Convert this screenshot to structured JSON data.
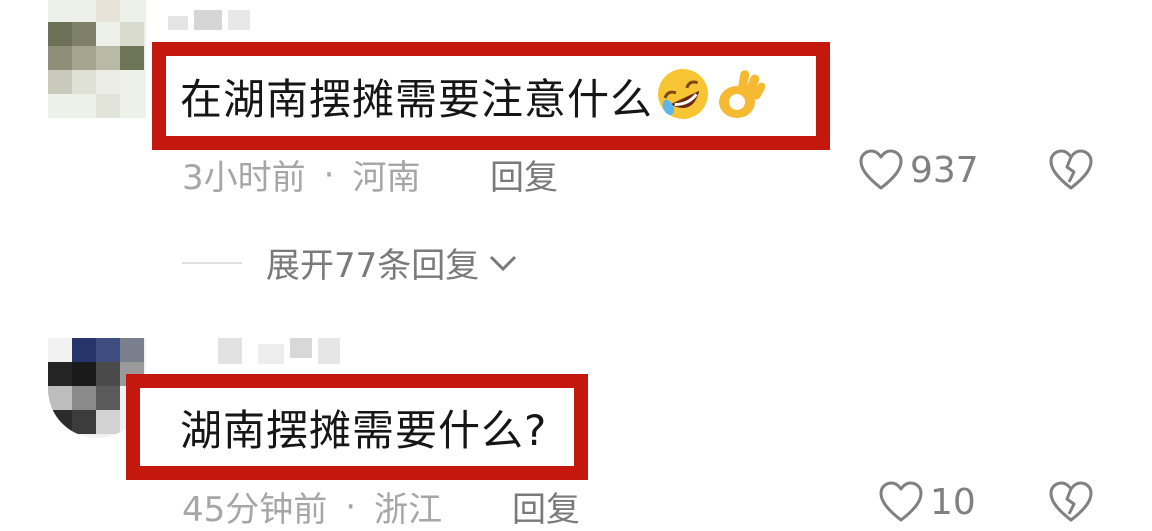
{
  "comments": [
    {
      "text": "在湖南摆摊需要注意什么",
      "emojis": [
        "rolling-on-floor-laughing-emoji",
        "ok-hand-emoji"
      ],
      "time": "3小时前",
      "location": "河南",
      "reply_label": "回复",
      "like_count": "937",
      "expand_label": "展开77条回复",
      "highlight_color": "#c4180f"
    },
    {
      "text": "湖南摆摊需要什么?",
      "time": "45分钟前",
      "location": "浙江",
      "reply_label": "回复",
      "like_count": "10",
      "highlight_color": "#c4180f"
    }
  ],
  "icons": {
    "like": "heart-outline-icon",
    "dislike": "broken-heart-icon",
    "expand": "chevron-down-icon"
  },
  "colors": {
    "meta_text": "#a6a6a6",
    "action_text": "#7a7a7a",
    "highlight_border": "#c4180f"
  }
}
